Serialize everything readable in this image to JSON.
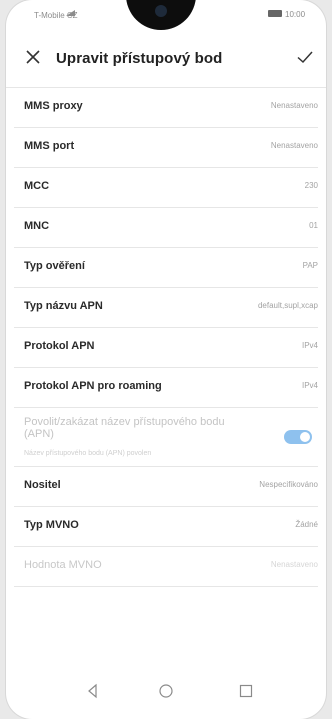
{
  "status": {
    "carrier": "T-Mobile CZ",
    "time": "10:00"
  },
  "header": {
    "title": "Upravit přístupový bod"
  },
  "rows": [
    {
      "label": "MMS proxy",
      "value": "Nenastaveno"
    },
    {
      "label": "MMS port",
      "value": "Nenastaveno"
    },
    {
      "label": "MCC",
      "value": "230"
    },
    {
      "label": "MNC",
      "value": "01"
    },
    {
      "label": "Typ ověření",
      "value": "PAP"
    },
    {
      "label": "Typ názvu APN",
      "value": "default,supl,xcap"
    },
    {
      "label": "Protokol APN",
      "value": "IPv4"
    },
    {
      "label": "Protokol APN pro roaming",
      "value": "IPv4"
    }
  ],
  "toggle": {
    "label": "Povolit/zakázat název přístupového bodu (APN)",
    "sub": "Název přístupového bodu (APN) povolen",
    "state": "on"
  },
  "rows2": [
    {
      "label": "Nositel",
      "value": "Nespecifikováno"
    },
    {
      "label": "Typ MVNO",
      "value": "Žádné"
    },
    {
      "label": "Hodnota MVNO",
      "value": "Nenastaveno"
    }
  ],
  "colors": {
    "accent": "#8ec1ee"
  },
  "icons": {
    "close": "close-icon",
    "confirm": "check-icon",
    "nav_back": "back-triangle-icon",
    "nav_home": "home-circle-icon",
    "nav_recent": "recent-square-icon"
  }
}
